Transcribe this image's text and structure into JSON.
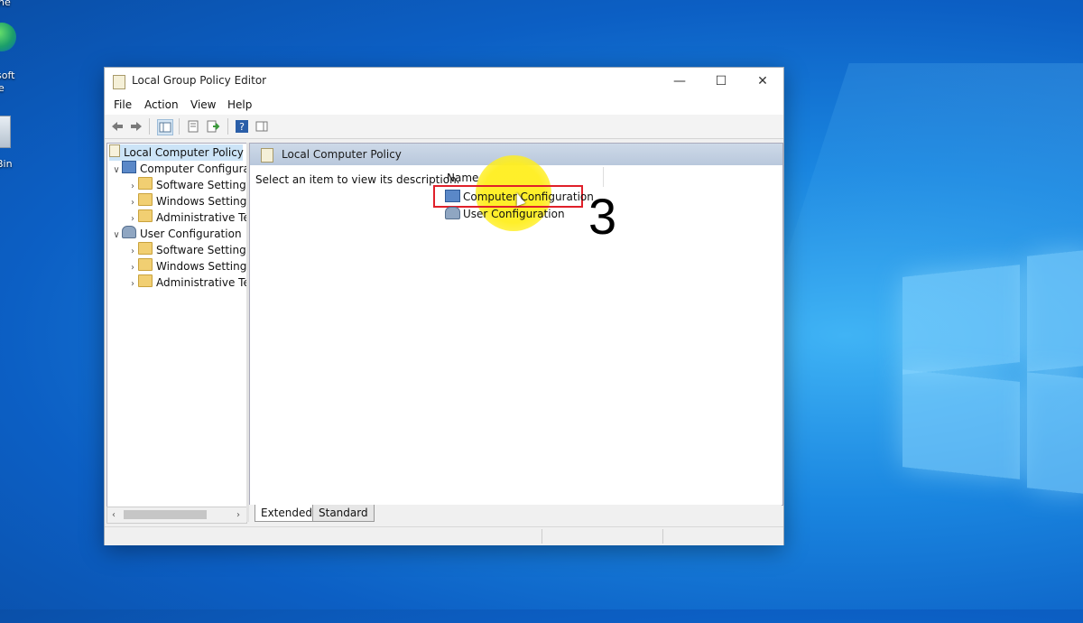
{
  "desktop": {
    "icons": [
      {
        "label": "soft",
        "sublabel": "e",
        "icon": "edge-icon"
      },
      {
        "label": "Bin",
        "icon": "recycle-bin-icon"
      }
    ],
    "top_fragment": "ne"
  },
  "window": {
    "title": "Local Group Policy Editor",
    "controls": {
      "minimize": "—",
      "maximize": "☐",
      "close": "✕"
    }
  },
  "menu": {
    "file": "File",
    "action": "Action",
    "view": "View",
    "help": "Help"
  },
  "toolbar": {
    "buttons": [
      "back-icon",
      "forward-icon",
      "show-hide-tree-icon",
      "properties-icon",
      "export-list-icon",
      "help-icon",
      "show-action-pane-icon"
    ]
  },
  "tree": {
    "root": "Local Computer Policy",
    "computer": {
      "label": "Computer Configura",
      "children": [
        "Software Settings",
        "Windows Setting",
        "Administrative Te"
      ]
    },
    "user": {
      "label": "User Configuration",
      "children": [
        "Software Settings",
        "Windows Setting",
        "Administrative Te"
      ]
    }
  },
  "content": {
    "header_title": "Local Computer Policy",
    "description": "Select an item to view its description.",
    "column_name": "Name",
    "items": [
      "Computer Configuration",
      "User Configuration"
    ]
  },
  "tabs": {
    "extended": "Extended",
    "standard": "Standard"
  },
  "annotation": {
    "step": "3",
    "box_color": "#e0202a",
    "highlight_color": "#ffee1e"
  }
}
